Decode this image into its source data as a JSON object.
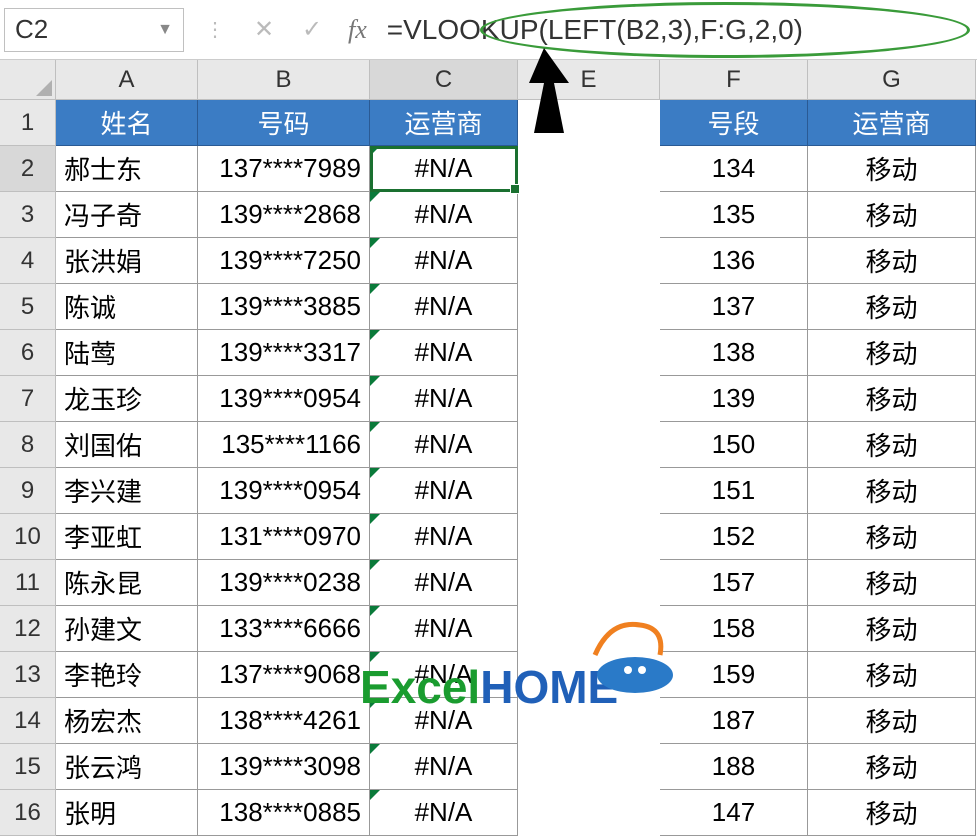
{
  "name_box": "C2",
  "formula": "=VLOOKUP(LEFT(B2,3),F:G,2,0)",
  "fx_label": "fx",
  "columns": [
    "A",
    "B",
    "C",
    "E",
    "F",
    "G"
  ],
  "col_widths": {
    "A": 142,
    "B": 172,
    "C": 148,
    "E": 142,
    "F": 148,
    "G": 168
  },
  "headers_left": {
    "A": "姓名",
    "B": "号码",
    "C": "运营商"
  },
  "headers_right": {
    "F": "号段",
    "G": "运营商"
  },
  "rows": [
    {
      "n": 2,
      "A": "郝士东",
      "B": "137****7989",
      "C": "#N/A",
      "F": "134",
      "G": "移动"
    },
    {
      "n": 3,
      "A": "冯子奇",
      "B": "139****2868",
      "C": "#N/A",
      "F": "135",
      "G": "移动"
    },
    {
      "n": 4,
      "A": "张洪娟",
      "B": "139****7250",
      "C": "#N/A",
      "F": "136",
      "G": "移动"
    },
    {
      "n": 5,
      "A": "陈诚",
      "B": "139****3885",
      "C": "#N/A",
      "F": "137",
      "G": "移动"
    },
    {
      "n": 6,
      "A": "陆莺",
      "B": "139****3317",
      "C": "#N/A",
      "F": "138",
      "G": "移动"
    },
    {
      "n": 7,
      "A": "龙玉珍",
      "B": "139****0954",
      "C": "#N/A",
      "F": "139",
      "G": "移动"
    },
    {
      "n": 8,
      "A": "刘国佑",
      "B": "135****1166",
      "C": "#N/A",
      "F": "150",
      "G": "移动"
    },
    {
      "n": 9,
      "A": "李兴建",
      "B": "139****0954",
      "C": "#N/A",
      "F": "151",
      "G": "移动"
    },
    {
      "n": 10,
      "A": "李亚虹",
      "B": "131****0970",
      "C": "#N/A",
      "F": "152",
      "G": "移动"
    },
    {
      "n": 11,
      "A": "陈永昆",
      "B": "139****0238",
      "C": "#N/A",
      "F": "157",
      "G": "移动"
    },
    {
      "n": 12,
      "A": "孙建文",
      "B": "133****6666",
      "C": "#N/A",
      "F": "158",
      "G": "移动"
    },
    {
      "n": 13,
      "A": "李艳玲",
      "B": "137****9068",
      "C": "#N/A",
      "F": "159",
      "G": "移动"
    },
    {
      "n": 14,
      "A": "杨宏杰",
      "B": "138****4261",
      "C": "#N/A",
      "F": "187",
      "G": "移动"
    },
    {
      "n": 15,
      "A": "张云鸿",
      "B": "139****3098",
      "C": "#N/A",
      "F": "188",
      "G": "移动"
    },
    {
      "n": 16,
      "A": "张明",
      "B": "138****0885",
      "C": "#N/A",
      "F": "147",
      "G": "移动"
    }
  ],
  "watermark": {
    "prefix": "E",
    "mid": "xcel",
    "suffix": "HOME"
  },
  "selected_cell": "C2"
}
